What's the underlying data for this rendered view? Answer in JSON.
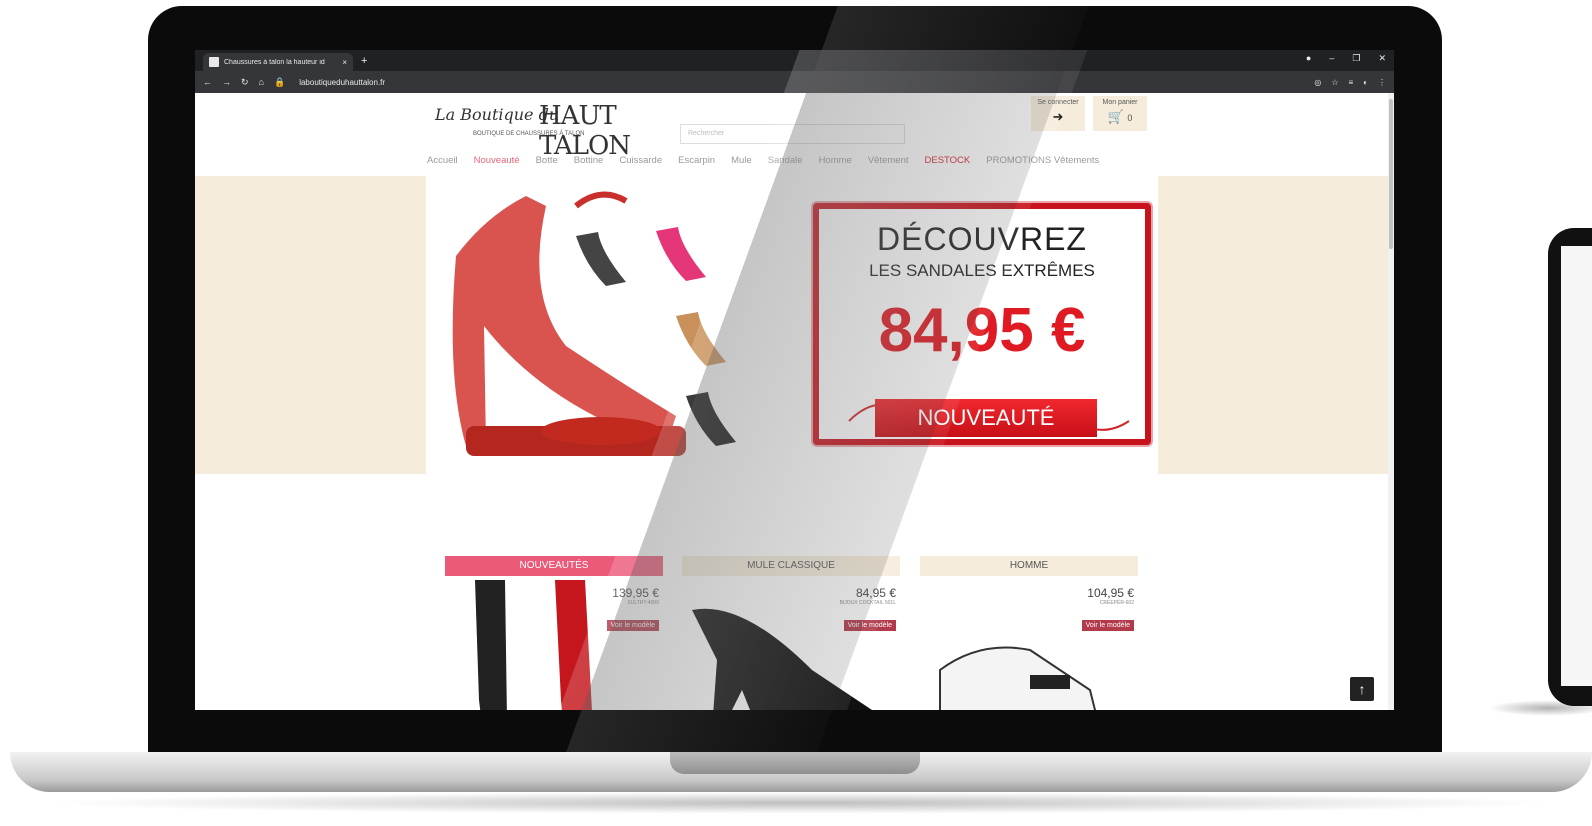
{
  "browser": {
    "tab_title": "Chaussures à talon la hauteur id",
    "tab_close": "×",
    "new_tab": "+",
    "url": "laboutiqueduhauttalon.fr"
  },
  "site": {
    "logo_script": "La Boutique du",
    "logo_caps": "HAUT TALON",
    "logo_tagline": "BOUTIQUE DE CHAUSSURES À TALON",
    "search_placeholder": "Rechercher",
    "login_label": "Se connecter",
    "cart_label": "Mon panier",
    "cart_count": "0"
  },
  "nav": {
    "items": [
      "Accueil",
      "Nouveauté",
      "Botte",
      "Bottine",
      "Cuissarde",
      "Escarpin",
      "Mule",
      "Sandale",
      "Homme",
      "Vêtement",
      "DESTOCK",
      "PROMOTIONS Vêtements"
    ]
  },
  "hero": {
    "title": "DÉCOUVREZ",
    "subtitle": "LES SANDALES EXTRÊMES",
    "price": "84,95 €",
    "button": "NOUVEAUTÉ"
  },
  "categories": [
    {
      "label": "NOUVEAUTÉS",
      "price": "139,95 €",
      "ref": "SULTRY-4000",
      "button": "Voir le modèle"
    },
    {
      "label": "MULE CLASSIQUE",
      "price": "84,95 €",
      "ref": "BIJOUX COCKTAIL 501L",
      "button": "Voir le modèle"
    },
    {
      "label": "HOMME",
      "price": "104,95 €",
      "ref": "CREEPER-602",
      "button": "Voir le modèle"
    }
  ],
  "colors": {
    "accent_pink": "#ec5a7a",
    "promo_red": "#e01a22",
    "cream": "#f5ecdb"
  }
}
